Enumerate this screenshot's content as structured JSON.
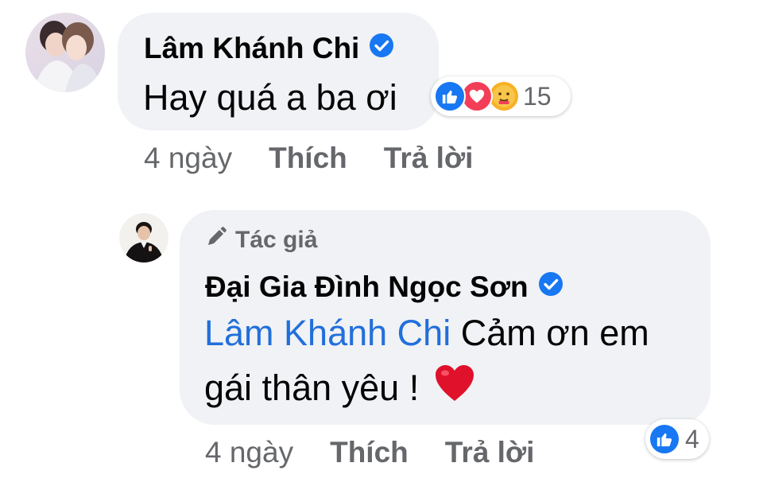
{
  "comment": {
    "author": "Lâm Khánh Chi",
    "text": "Hay quá a ba ơi",
    "reaction_count": "15",
    "reactions": [
      "like-icon",
      "love-icon",
      "care-icon"
    ],
    "time": "4 ngày",
    "like_label": "Thích",
    "reply_label": "Trả lời"
  },
  "reply": {
    "author_badge": "Tác giả",
    "author": "Đại Gia Đình Ngọc Sơn",
    "mention": "Lâm Khánh Chi",
    "text_line1": " Cảm ơn em",
    "text_line2": "gái thân yêu ! ",
    "emoji": "❤️",
    "reaction_count": "4",
    "reactions": [
      "like-icon"
    ],
    "time": "4 ngày",
    "like_label": "Thích",
    "reply_label": "Trả lời"
  },
  "colors": {
    "bubble": "#f0f2f5",
    "secondary_text": "#65676b",
    "mention": "#216fdb",
    "verified": "#1877f2",
    "like": "#1877f2",
    "love": "#f33e58",
    "care": "#f7b125"
  }
}
